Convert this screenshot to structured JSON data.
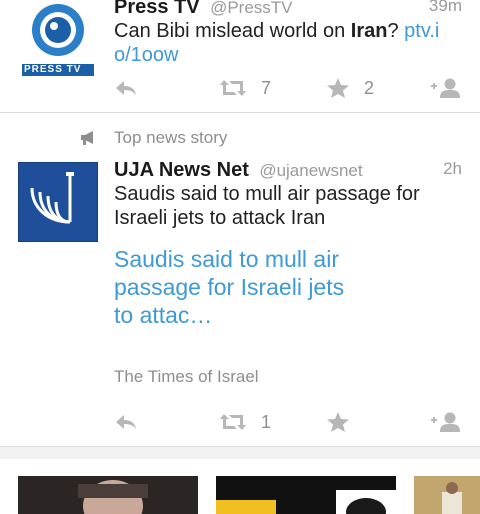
{
  "tweet1": {
    "name": "Press TV",
    "handle": "@PressTV",
    "time": "39m",
    "text_before": "Can Bibi mislead world on ",
    "text_bold": "Iran",
    "text_after": "? ",
    "link": "ptv.io/1oow",
    "retweet_count": "7",
    "favorite_count": "2",
    "avatar_label": "PRESS TV"
  },
  "promoted_label": "Top news story",
  "tweet2": {
    "name": "UJA News Net",
    "handle": "@ujanewsnet",
    "time": "2h",
    "text": "Saudis said to mull air passage for Israeli jets to attack Iran",
    "card_title": "Saudis said to mull air passage for Israeli jets to attac…",
    "card_source": "The Times of Israel",
    "retweet_count": "1"
  },
  "colors": {
    "link": "#3d9ad6",
    "muted": "#9a9a9a",
    "presstv_blue": "#1b5fa8",
    "uja_blue": "#1f4f9a"
  },
  "icons": [
    "reply-icon",
    "retweet-icon",
    "favorite-icon",
    "follow-icon",
    "megaphone-icon"
  ]
}
